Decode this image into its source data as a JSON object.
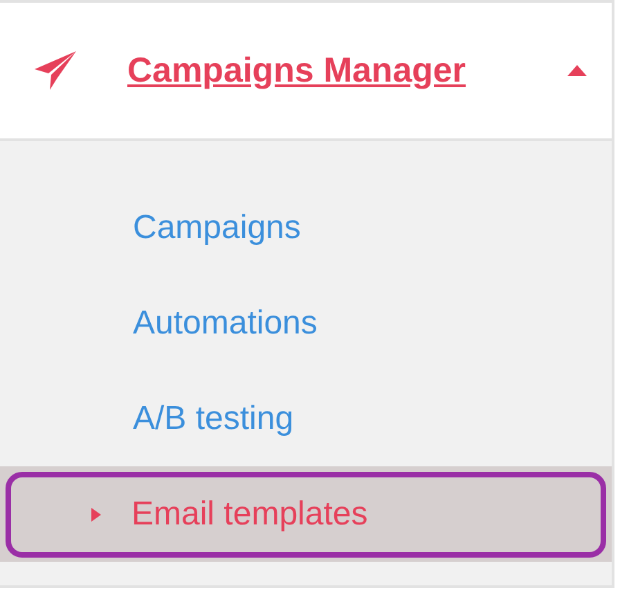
{
  "menu": {
    "title": "Campaigns Manager",
    "expanded": true,
    "items": [
      {
        "label": "Campaigns",
        "selected": false
      },
      {
        "label": "Automations",
        "selected": false
      },
      {
        "label": "A/B testing",
        "selected": false
      },
      {
        "label": "Email templates",
        "selected": true
      }
    ]
  }
}
